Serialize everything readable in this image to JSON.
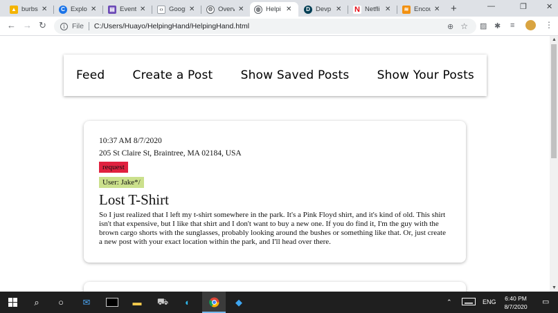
{
  "browser": {
    "tabs": [
      {
        "title": "burbs",
        "icon": "drive-icon",
        "color": "#f4b400"
      },
      {
        "title": "Explo",
        "icon": "explorer-icon",
        "color": "#1a73e8"
      },
      {
        "title": "Event",
        "icon": "calendar-icon",
        "color": "#6c4ab6"
      },
      {
        "title": "Googl",
        "icon": "code-icon",
        "color": "#5f6368"
      },
      {
        "title": "Overv",
        "icon": "settings-icon",
        "color": "#5f6368"
      },
      {
        "title": "Helpi",
        "icon": "globe-icon",
        "color": "#5f6368"
      },
      {
        "title": "Devp",
        "icon": "devpost-icon",
        "color": "#003e54"
      },
      {
        "title": "Netfli",
        "icon": "netflix-icon",
        "color": "#e50914"
      },
      {
        "title": "Encou",
        "icon": "rss-icon",
        "color": "#f29111"
      }
    ],
    "active_tab": 5,
    "address": {
      "scheme_label": "File",
      "url": "C:/Users/Huayo/HelpingHand/HelpingHand.html"
    }
  },
  "nav": {
    "items": [
      "Feed",
      "Create a Post",
      "Show Saved Posts",
      "Show Your Posts"
    ]
  },
  "post": {
    "time": "10:37 AM 8/7/2020",
    "address": "205 St Claire St, Braintree, MA 02184, USA",
    "type_badge": "request",
    "user_badge": "User: Jake*/",
    "title": "Lost T-Shirt",
    "body": "So I just realized that I left my t-shirt somewhere in the park. It's a Pink Floyd shirt, and it's kind of old. This shirt isn't that expensive, but I like that shirt and I don't want to buy a new one. If you do find it, I'm the guy with the brown cargo shorts with the sunglasses, probably looking around the bushes or something like that. Or, just create a new post with your exact location within the park, and I'll head over there."
  },
  "taskbar": {
    "language": "ENG",
    "time": "6:40 PM",
    "date": "8/7/2020"
  }
}
